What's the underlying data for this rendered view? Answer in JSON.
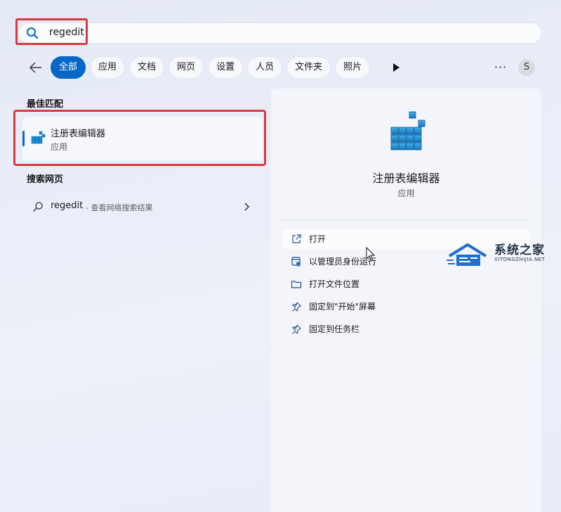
{
  "search": {
    "query": "regedit",
    "placeholder": ""
  },
  "filters": {
    "items": [
      "全部",
      "应用",
      "文档",
      "网页",
      "设置",
      "人员",
      "文件夹",
      "照片"
    ],
    "active_index": 0
  },
  "account": {
    "initial": "S"
  },
  "left": {
    "best_match_heading": "最佳匹配",
    "best_match": {
      "name": "注册表编辑器",
      "type": "应用"
    },
    "web_heading": "搜索网页",
    "web_result": {
      "query": "regedit",
      "suffix": " - 查看网络搜索结果"
    }
  },
  "detail": {
    "name": "注册表编辑器",
    "type": "应用",
    "actions": [
      {
        "label": "打开",
        "icon": "open-external-icon"
      },
      {
        "label": "以管理员身份运行",
        "icon": "shield-run-icon"
      },
      {
        "label": "打开文件位置",
        "icon": "folder-icon"
      },
      {
        "label": "固定到\"开始\"屏幕",
        "icon": "pin-icon"
      },
      {
        "label": "固定到任务栏",
        "icon": "pin-icon"
      }
    ]
  },
  "watermark": {
    "title": "系统之家",
    "subtitle": "XITONGZHIJIA.NET"
  },
  "colors": {
    "accent": "#0767c4",
    "highlight": "#d9393f",
    "registry_blue": "#1e8fd6"
  }
}
